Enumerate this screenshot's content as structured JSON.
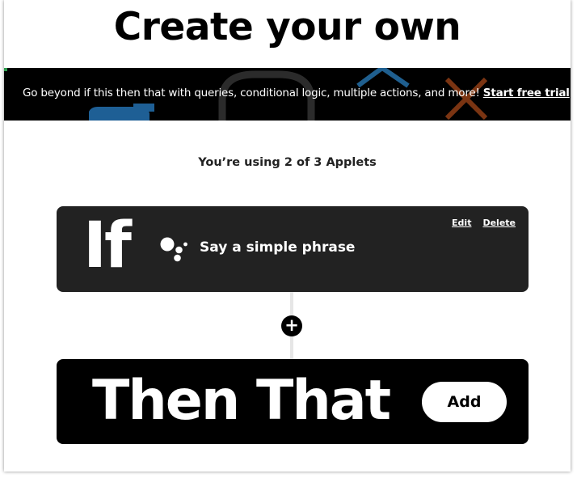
{
  "page": {
    "title": "Create your own"
  },
  "promo": {
    "text": "Go beyond if this then that with queries, conditional logic, multiple actions, and more!",
    "link_label": "Start free trial"
  },
  "usage": {
    "text": "You’re using 2 of 3 Applets"
  },
  "if_card": {
    "keyword": "If",
    "service_icon": "google-assistant-icon",
    "trigger_label": "Say a simple phrase",
    "edit_label": "Edit",
    "delete_label": "Delete"
  },
  "connector": {
    "plus_icon": "plus-icon"
  },
  "then_card": {
    "keyword": "Then That",
    "add_label": "Add"
  },
  "colors": {
    "if_card_bg": "#222222",
    "then_card_bg": "#000000",
    "promo_bg": "#000000"
  }
}
